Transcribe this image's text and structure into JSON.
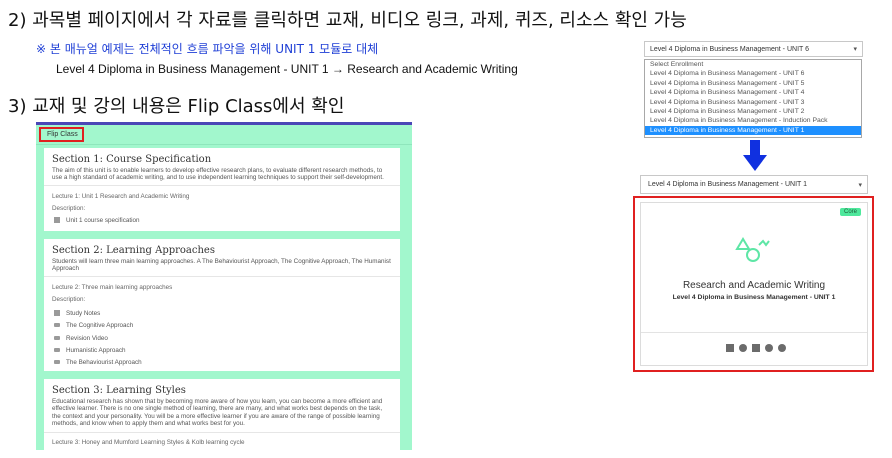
{
  "instructions": {
    "step2": "2) 과목별 페이지에서 각 자료를 클릭하면 교재, 비디오 링크, 과제, 퀴즈, 리소스 확인 가능",
    "note": "※ 본 매뉴얼 예제는 전체적인 흐름 파악을 위해 UNIT 1 모듈로 대체",
    "path": "Level 4 Diploma in Business Management - UNIT 1 → Research and Academic Writing",
    "step3": "3) 교재 및 강의 내용은 Flip Class에서 확인"
  },
  "flip_class": {
    "tab_label": "Flip Class",
    "sections": [
      {
        "title": "Section 1: Course Specification",
        "description": "The aim of this unit is to enable learners to develop effective research plans, to evaluate different research methods, to use a high standard of academic writing, and to use independent learning techniques to support their self-development.",
        "lecture": "Lecture 1: Unit 1 Research and Academic Writing",
        "description_label": "Description:",
        "items": [
          {
            "label": "Unit 1 course specification",
            "icon": "document-icon"
          }
        ]
      },
      {
        "title": "Section 2: Learning Approaches",
        "description": "Students will learn three main learning approaches. A The Behaviourist Approach, The Cognitive Approach, The Humanist Approach",
        "lecture": "Lecture 2: Three main learning approaches",
        "description_label": "Description:",
        "items": [
          {
            "label": "Study Notes",
            "icon": "document-icon"
          },
          {
            "label": "The Cognitive Approach",
            "icon": "video-icon"
          },
          {
            "label": "Revision Video",
            "icon": "video-icon"
          },
          {
            "label": "Humanistic Approach",
            "icon": "video-icon"
          },
          {
            "label": "The Behaviourist Approach",
            "icon": "video-icon"
          }
        ]
      },
      {
        "title": "Section 3: Learning Styles",
        "description": "Educational research has shown that by becoming more aware of how you learn, you can become a more efficient and effective learner. There is no one single method of learning, there are many, and what works best depends on the task, the context and your personality. You will be a more effective learner if you are aware of the range of possible learning methods, and know when to apply them and what works best for you.",
        "lecture": "Lecture 3: Honey and Mumford Learning Styles & Kolb learning cycle"
      }
    ]
  },
  "enrollment": {
    "selected": "Level 4 Diploma in Business Management - UNIT 6",
    "options": [
      "Select Enrollment",
      "Level 4 Diploma in Business Management - UNIT 6",
      "Level 4 Diploma in Business Management - UNIT 5",
      "Level 4 Diploma in Business Management - UNIT 4",
      "Level 4 Diploma in Business Management - UNIT 3",
      "Level 4 Diploma in Business Management - UNIT 2",
      "Level 4 Diploma in Business Management - Induction Pack",
      "Level 4 Diploma in Business Management - UNIT 1"
    ],
    "highlighted_index": 7,
    "after_selected": "Level 4 Diploma in Business Management - UNIT 1"
  },
  "course_card": {
    "badge": "Core",
    "title": "Research and Academic Writing",
    "subtitle": "Level 4 Diploma in Business Management - UNIT 1",
    "icons": [
      "book-icon",
      "chat-icon",
      "list-icon",
      "help-icon",
      "cloud-download-icon"
    ]
  },
  "colors": {
    "panel_bg": "#a2f7cd",
    "panel_top": "#4b47b7",
    "highlight_red": "#e02020",
    "selection_blue": "#1e90ff",
    "note_blue": "#1f3fd6",
    "badge_green": "#4ee89c"
  }
}
